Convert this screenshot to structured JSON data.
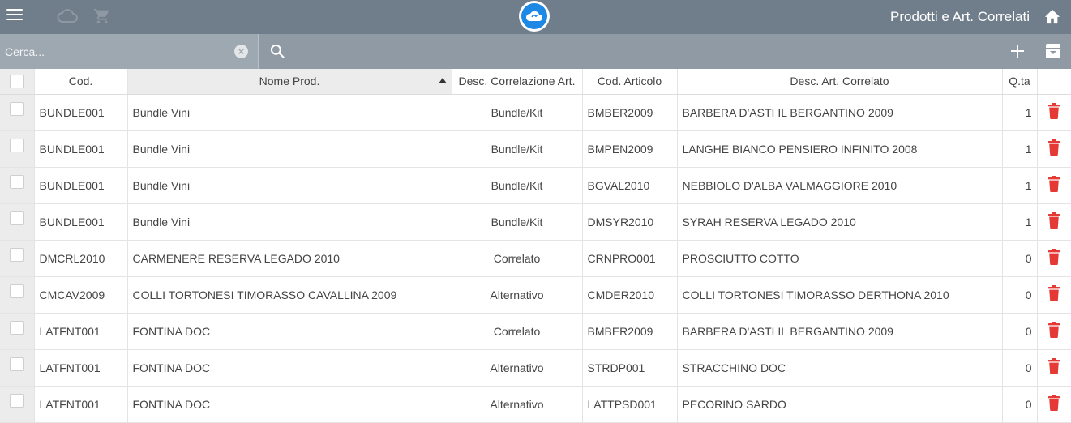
{
  "app": {
    "title": "Prodotti e Art. Correlati",
    "icons": [
      "menu-icon",
      "cloud-icon",
      "cart-icon",
      "cloud-sync-logo",
      "home-icon"
    ]
  },
  "search": {
    "placeholder": "Cerca...",
    "value": "",
    "icons": [
      "clear-icon",
      "search-icon",
      "plus-icon",
      "archive-icon"
    ]
  },
  "table": {
    "sorted_column": "Nome Prod.",
    "sort_direction": "ascending",
    "headers": {
      "cod": "Cod.",
      "nome": "Nome Prod.",
      "desc_corr": "Desc. Correlazione Art.",
      "cod_art": "Cod. Articolo",
      "desc_art": "Desc. Art. Correlato",
      "qta": "Q.ta"
    },
    "rows": [
      {
        "cod": "BUNDLE001",
        "nome": "Bundle Vini",
        "desc_corr": "Bundle/Kit",
        "cod_art": "BMBER2009",
        "desc_art": "BARBERA D'ASTI IL BERGANTINO 2009",
        "qta": "1"
      },
      {
        "cod": "BUNDLE001",
        "nome": "Bundle Vini",
        "desc_corr": "Bundle/Kit",
        "cod_art": "BMPEN2009",
        "desc_art": "LANGHE BIANCO PENSIERO INFINITO 2008",
        "qta": "1"
      },
      {
        "cod": "BUNDLE001",
        "nome": "Bundle Vini",
        "desc_corr": "Bundle/Kit",
        "cod_art": "BGVAL2010",
        "desc_art": "NEBBIOLO D'ALBA VALMAGGIORE 2010",
        "qta": "1"
      },
      {
        "cod": "BUNDLE001",
        "nome": "Bundle Vini",
        "desc_corr": "Bundle/Kit",
        "cod_art": "DMSYR2010",
        "desc_art": "SYRAH RESERVA LEGADO 2010",
        "qta": "1"
      },
      {
        "cod": "DMCRL2010",
        "nome": "CARMENERE RESERVA LEGADO 2010",
        "desc_corr": "Correlato",
        "cod_art": "CRNPRO001",
        "desc_art": "PROSCIUTTO COTTO",
        "qta": "0"
      },
      {
        "cod": "CMCAV2009",
        "nome": "COLLI TORTONESI TIMORASSO CAVALLINA 2009",
        "desc_corr": "Alternativo",
        "cod_art": "CMDER2010",
        "desc_art": "COLLI TORTONESI TIMORASSO DERTHONA 2010",
        "qta": "0"
      },
      {
        "cod": "LATFNT001",
        "nome": "FONTINA DOC",
        "desc_corr": "Correlato",
        "cod_art": "BMBER2009",
        "desc_art": "BARBERA D'ASTI IL BERGANTINO 2009",
        "qta": "0"
      },
      {
        "cod": "LATFNT001",
        "nome": "FONTINA DOC",
        "desc_corr": "Alternativo",
        "cod_art": "STRDP001",
        "desc_art": "STRACCHINO DOC",
        "qta": "0"
      },
      {
        "cod": "LATFNT001",
        "nome": "FONTINA DOC",
        "desc_corr": "Alternativo",
        "cod_art": "LATTPSD001",
        "desc_art": "PECORINO SARDO",
        "qta": "0"
      }
    ]
  },
  "colors": {
    "topbar": "#707d8a",
    "searchbar": "#8f9aa5",
    "accent_blue": "#1e88e5",
    "delete_red": "#e53935"
  }
}
